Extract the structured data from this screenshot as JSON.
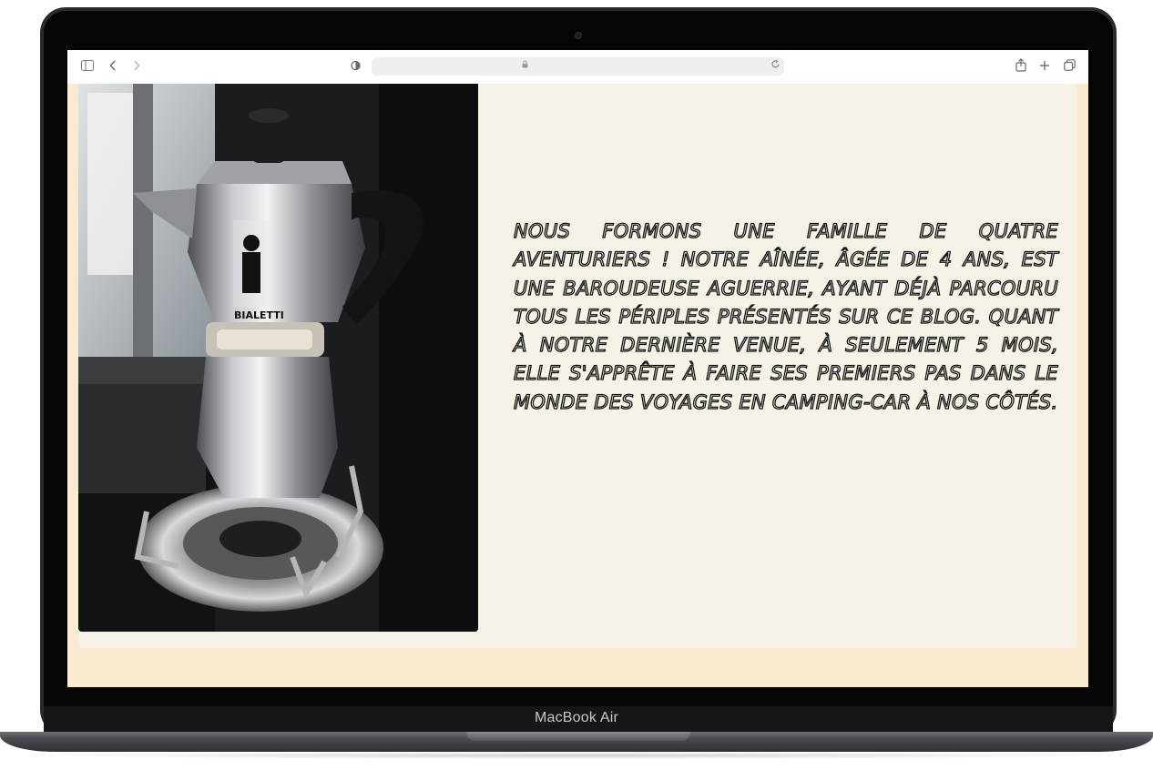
{
  "device": {
    "model_label": "MacBook Air"
  },
  "browser": {
    "icons": [
      "sidebar-icon",
      "back-arrow-icon",
      "forward-arrow-icon",
      "shield-icon",
      "lock-icon",
      "reload-icon",
      "share-icon",
      "new-tab-plus-icon",
      "tabs-overview-icon"
    ]
  },
  "page": {
    "background_color": "#f9ead0",
    "card_color": "#f7f2e7",
    "intro_text": "Nous formons une famille de quatre aventuriers ! Notre aînée, âgée de 4 ans, est une baroudeuse aguerrie, ayant déjà parcouru tous les périples présentés sur ce blog. Quant à notre dernière venue, à seulement 5 mois, elle s'apprête à faire ses premiers pas dans le monde des voyages en camping-car à nos côtés."
  }
}
